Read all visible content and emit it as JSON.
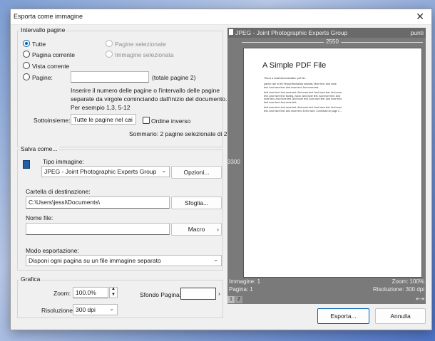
{
  "window": {
    "title": "Esporta come immagine"
  },
  "page_range": {
    "group_title": "Intervallo pagine",
    "options": {
      "all": "Tutte",
      "selected_pages": "Pagine selezionate",
      "current_page": "Pagina corrente",
      "selected_image": "Immagine selezionata",
      "current_view": "Vista corrente",
      "pages": "Pagine:"
    },
    "pages_value": "",
    "total_pages": "(totale pagine 2)",
    "help_line1": "Inserire il numero delle pagine o l'intervallo delle pagine",
    "help_line2": "separate da virgole cominciando dall'inizio del documento.",
    "help_line3": "Per esempio 1,3, 5-12",
    "subset_label": "Sottoinsieme:",
    "subset_value": "Tutte le pagine nel cai",
    "reverse_label": "Ordine inverso",
    "summary": "Sommario: 2 pagine selezionate di 2"
  },
  "save_as": {
    "group_title": "Salva come...",
    "image_type_label": "Tipo immagine:",
    "image_type_value": "JPEG - Joint Photographic Experts Group",
    "options_button": "Opzioni...",
    "dest_label": "Cartella di destinazione:",
    "dest_value": "C:\\Users\\jessi\\Documents\\",
    "browse_button": "Sfoglia...",
    "filename_label": "Nome file:",
    "filename_value": "",
    "macro_button": "Macro",
    "export_mode_label": "Modo esportazione:",
    "export_mode_value": "Disponi ogni pagina su un file immagine separato"
  },
  "graphics": {
    "group_title": "Grafica",
    "zoom_label": "Zoom:",
    "zoom_value": "100.0%",
    "background_label": "Sfondo Pagina:",
    "resolution_label": "Risoluzione:",
    "resolution_value": "300 dpi"
  },
  "preview": {
    "format": "JPEG - Joint Photographic Experts Group",
    "units": "punti",
    "width_value": "2550",
    "height_value": "3300",
    "doc_title": "A Simple PDF File",
    "doc_lines": [
      "This is a small demonstration .pdf file -",
      "just for use in the Virtual Mechanics tutorials. More text. And more",
      "text. And more text. And more text. And more text.",
      "And more text. And more text. And more text. And more text. And more",
      "text. And more text. Boring, zzzzz. And more text. And more text. And",
      "more text. And more text. And more text. And more text. And more text.",
      "And more text. And more text.",
      "And more text. And more text. And more text. And more text. And more",
      "text. And more text. And more text. Even more. Continued on page 2 ..."
    ],
    "image_status": "Immagine: 1",
    "page_status": "Pagina: 1",
    "zoom_status": "Zoom: 100%",
    "resolution_status": "Risoluzione: 300 dpi",
    "page_tabs": [
      "1",
      "2"
    ]
  },
  "footer": {
    "export_button": "Esporta...",
    "cancel_button": "Annulla"
  },
  "colors": {
    "accent": "#0063b1",
    "preview_bg": "#7a7a7a"
  }
}
